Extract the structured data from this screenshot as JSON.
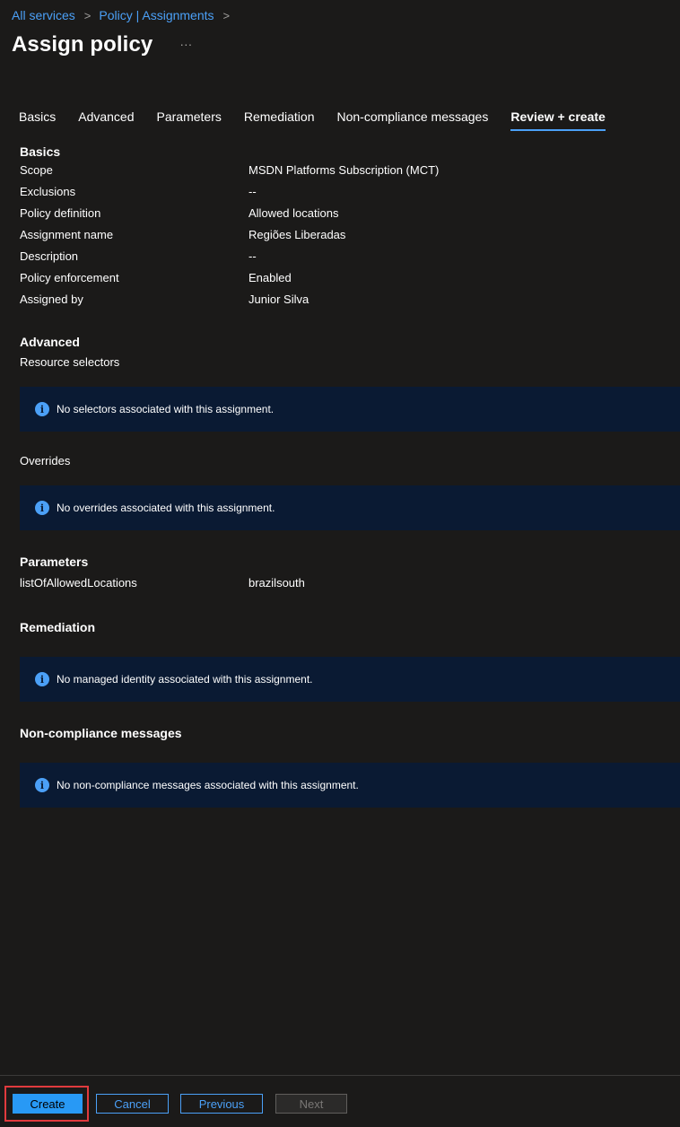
{
  "breadcrumb": {
    "items": [
      "All services",
      "Policy | Assignments"
    ],
    "separator": ">"
  },
  "header": {
    "title": "Assign policy",
    "more": "···"
  },
  "tabs": [
    "Basics",
    "Advanced",
    "Parameters",
    "Remediation",
    "Non-compliance messages",
    "Review + create"
  ],
  "active_tab": "Review + create",
  "basics": {
    "title": "Basics",
    "rows": [
      {
        "label": "Scope",
        "value": "MSDN Platforms Subscription (MCT)"
      },
      {
        "label": "Exclusions",
        "value": "--"
      },
      {
        "label": "Policy definition",
        "value": "Allowed locations"
      },
      {
        "label": "Assignment name",
        "value": "Regiões Liberadas"
      },
      {
        "label": "Description",
        "value": "--"
      },
      {
        "label": "Policy enforcement",
        "value": "Enabled"
      },
      {
        "label": "Assigned by",
        "value": "Junior Silva"
      }
    ]
  },
  "advanced": {
    "title": "Advanced",
    "resource_selectors_label": "Resource selectors",
    "resource_selectors_info": "No selectors associated with this assignment.",
    "overrides_label": "Overrides",
    "overrides_info": "No overrides associated with this assignment."
  },
  "parameters": {
    "title": "Parameters",
    "rows": [
      {
        "label": "listOfAllowedLocations",
        "value": "brazilsouth"
      }
    ]
  },
  "remediation": {
    "title": "Remediation",
    "info": "No managed identity associated with this assignment."
  },
  "noncompliance": {
    "title": "Non-compliance messages",
    "info": "No non-compliance messages associated with this assignment."
  },
  "footer": {
    "create_label": "Create",
    "cancel_label": "Cancel",
    "previous_label": "Previous",
    "next_label": "Next"
  },
  "icons": {
    "info": "info-icon",
    "chevron": "chevron-right-icon",
    "more": "more-icon"
  },
  "colors": {
    "accent": "#4ba0f7",
    "primary_button": "#2899f5",
    "info_bar": "#0a1a33",
    "highlight": "#e03a3e",
    "background": "#1b1a19"
  }
}
